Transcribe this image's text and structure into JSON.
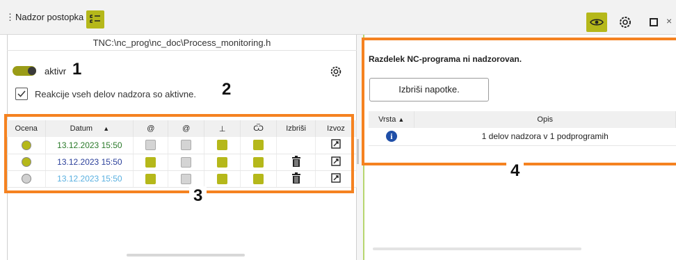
{
  "header": {
    "title": "Nadzor postopka",
    "menu_glyph": "⋮",
    "close_glyph": "×",
    "icons": [
      "list-check-icon",
      "eye-icon",
      "gear-icon",
      "maximize-icon",
      "close-icon"
    ]
  },
  "left": {
    "file_path": "TNC:\\nc_prog\\nc_doc\\Process_monitoring.h",
    "toggle_label": "aktivr",
    "toggle_on": true,
    "checkbox_label": "Reakcije vseh delov nadzora so aktivne.",
    "checkbox_checked": true,
    "table": {
      "columns": [
        "Ocena",
        "Datum",
        "",
        "",
        "",
        "",
        "Izbriši",
        "Izvoz"
      ],
      "sort_glyph": "▲",
      "column_icons": [
        "@",
        "@",
        "⊥",
        "Ѿ"
      ],
      "rows": [
        {
          "rating": "#b5b81a",
          "date": "13.12.2023 15:50",
          "date_color": "#2a7a2a",
          "c1": "gray",
          "c2": "gray",
          "c3": "yellow",
          "c4": "yellow",
          "delete": false,
          "export": true
        },
        {
          "rating": "#b5b81a",
          "date": "13.12.2023 15:50",
          "date_color": "#2a3f9a",
          "c1": "yellow",
          "c2": "gray",
          "c3": "yellow",
          "c4": "yellow",
          "delete": true,
          "export": true
        },
        {
          "rating": "#d0d0d0",
          "date": "13.12.2023 15:50",
          "date_color": "#5ab0e0",
          "c1": "yellow",
          "c2": "gray",
          "c3": "yellow",
          "c4": "yellow",
          "delete": true,
          "export": true
        }
      ]
    }
  },
  "right": {
    "status_title": "Razdelek NC-programa ni nadzorovan.",
    "clear_button": "Izbriši napotke.",
    "table": {
      "columns": [
        "Vrsta",
        "Opis"
      ],
      "sort_glyph": "▲",
      "rows": [
        {
          "type_icon": "info-icon",
          "type_glyph": "i",
          "description": "1 delov nadzora v 1 podprogramih"
        }
      ]
    }
  },
  "callouts": [
    "1",
    "2",
    "3",
    "4"
  ],
  "colors": {
    "accent": "#b5b81a",
    "callout": "#f58220",
    "info": "#1f4fa8"
  }
}
